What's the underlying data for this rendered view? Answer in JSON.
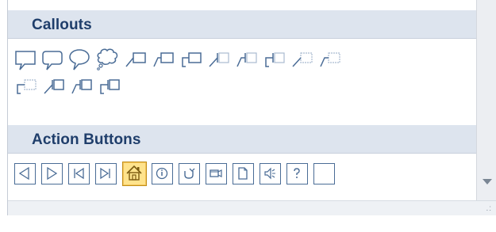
{
  "sections": {
    "callouts": {
      "title": "Callouts"
    },
    "action_buttons": {
      "title": "Action Buttons"
    }
  },
  "callout_shapes": [
    "rectangular-callout-icon",
    "rounded-rectangular-callout-icon",
    "oval-callout-icon",
    "cloud-callout-icon",
    "line-callout-1-icon",
    "line-callout-2-icon",
    "line-callout-3-icon",
    "line-callout-1-accent-bar-icon",
    "line-callout-2-accent-bar-icon",
    "line-callout-3-accent-bar-icon",
    "line-callout-1-no-border-icon",
    "line-callout-2-no-border-icon",
    "line-callout-3-no-border-icon",
    "line-callout-1-border-and-accent-bar-icon",
    "line-callout-2-border-and-accent-bar-icon",
    "line-callout-3-border-and-accent-bar-icon"
  ],
  "action_buttons": [
    {
      "name": "action-back-icon"
    },
    {
      "name": "action-forward-icon"
    },
    {
      "name": "action-beginning-icon"
    },
    {
      "name": "action-end-icon"
    },
    {
      "name": "action-home-icon",
      "selected": true
    },
    {
      "name": "action-information-icon"
    },
    {
      "name": "action-return-icon"
    },
    {
      "name": "action-movie-icon"
    },
    {
      "name": "action-document-icon"
    },
    {
      "name": "action-sound-icon"
    },
    {
      "name": "action-help-icon"
    },
    {
      "name": "action-custom-icon"
    }
  ],
  "colors": {
    "accent": "#1f3e6b",
    "icon_stroke": "#4a6c96",
    "selected_fill": "#ffe38c",
    "header_bg": "#dde4ee"
  }
}
